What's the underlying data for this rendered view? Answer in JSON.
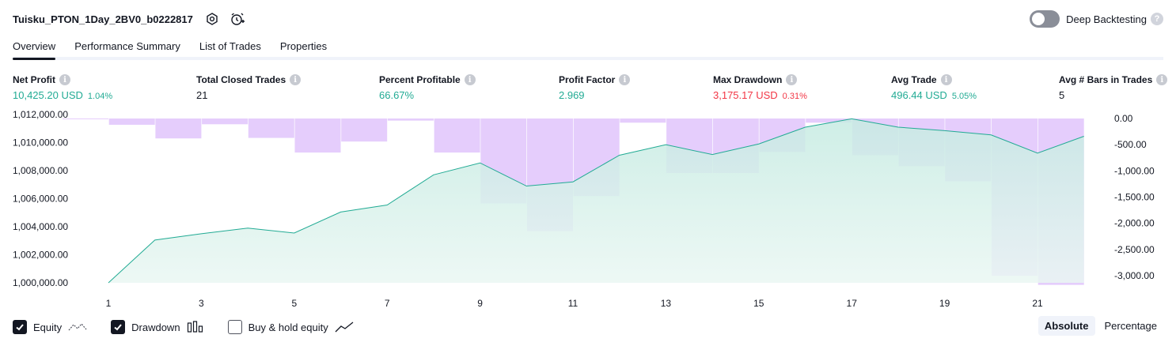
{
  "header": {
    "title": "Tuisku_PTON_1Day_2BV0_b0222817",
    "deep_backtesting_label": "Deep Backtesting",
    "help_mark": "?"
  },
  "tabs": [
    {
      "label": "Overview",
      "active": true
    },
    {
      "label": "Performance Summary",
      "active": false
    },
    {
      "label": "List of Trades",
      "active": false
    },
    {
      "label": "Properties",
      "active": false
    }
  ],
  "metrics": {
    "info_mark": "i",
    "net_profit": {
      "label": "Net Profit",
      "value": "10,425.20 USD",
      "sub": "1.04%"
    },
    "total_closed_trades": {
      "label": "Total Closed Trades",
      "value": "21"
    },
    "percent_profitable": {
      "label": "Percent Profitable",
      "value": "66.67%"
    },
    "profit_factor": {
      "label": "Profit Factor",
      "value": "2.969"
    },
    "max_drawdown": {
      "label": "Max Drawdown",
      "value": "3,175.17 USD",
      "sub": "0.31%"
    },
    "avg_trade": {
      "label": "Avg Trade",
      "value": "496.44 USD",
      "sub": "5.05%"
    },
    "avg_bars": {
      "label": "Avg # Bars in Trades",
      "value": "5"
    }
  },
  "chart_data": {
    "type": "area",
    "left_axis": {
      "ticks": [
        "1,000,000.00",
        "1,002,000.00",
        "1,004,000.00",
        "1,006,000.00",
        "1,008,000.00",
        "1,010,000.00",
        "1,012,000.00"
      ],
      "range": [
        1000000,
        1012000
      ]
    },
    "right_axis": {
      "ticks": [
        "0.00",
        "-500.00",
        "-1,000.00",
        "-1,500.00",
        "-2,000.00",
        "-2,500.00",
        "-3,000.00"
      ],
      "range": [
        0,
        -3150
      ]
    },
    "x_ticks": [
      "1",
      "3",
      "5",
      "7",
      "9",
      "11",
      "13",
      "15",
      "17",
      "19",
      "21"
    ],
    "x": [
      1,
      2,
      3,
      4,
      5,
      6,
      7,
      8,
      9,
      10,
      11,
      12,
      13,
      14,
      15,
      16,
      17,
      18,
      19,
      20,
      21,
      22
    ],
    "series": [
      {
        "name": "Equity",
        "values": [
          1000000,
          1003050,
          1003500,
          1003900,
          1003550,
          1005050,
          1005550,
          1007700,
          1008550,
          1006900,
          1007200,
          1009100,
          1009850,
          1009150,
          1009900,
          1011100,
          1011700,
          1011100,
          1010850,
          1010550,
          1009250,
          1010450
        ]
      },
      {
        "name": "Drawdown",
        "values": [
          -5,
          -120,
          -380,
          -110,
          -370,
          -650,
          -440,
          -40,
          -650,
          -1620,
          -2150,
          -1480,
          -80,
          -1040,
          -1040,
          -640,
          -80,
          -700,
          -910,
          -1200,
          -3000,
          -3175
        ]
      }
    ],
    "colors": {
      "equity_line": "#22ab94",
      "equity_fill": "#d4efe9",
      "drawdown_bar": "#e1c4fb"
    }
  },
  "legend": {
    "equity": {
      "label": "Equity",
      "checked": true
    },
    "drawdown": {
      "label": "Drawdown",
      "checked": true
    },
    "buy_hold": {
      "label": "Buy & hold equity",
      "checked": false
    }
  },
  "scale": {
    "absolute": "Absolute",
    "percentage": "Percentage",
    "selected": "Absolute"
  }
}
